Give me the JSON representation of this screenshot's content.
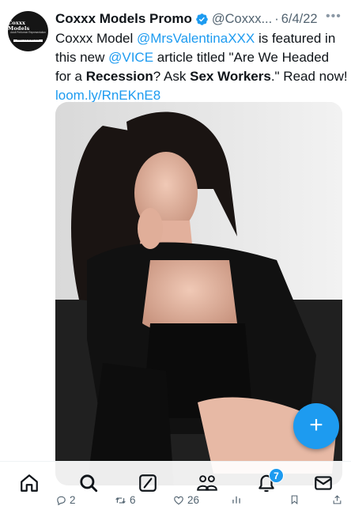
{
  "avatar": {
    "line1": "Coxxx Models",
    "line2": "Adult Performer Representation",
    "line3": "www.coxxmodels.com"
  },
  "tweet": {
    "display_name": "Coxxx Models Promo",
    "handle": "@Coxxx...",
    "separator": "·",
    "date": "6/4/22",
    "text": {
      "t1": "Coxxx Model ",
      "mention1": "@MrsValentinaXXX",
      "t2": " is featured in this new ",
      "mention2": "@VICE",
      "t3": " article titled \"Are We Headed for a ",
      "bold1": "Recession",
      "t4": "? Ask ",
      "bold2": "Sex Workers",
      "t5": ".\" Read now! ",
      "link": "loom.ly/RnEKnE8"
    }
  },
  "fab": {
    "label": "+"
  },
  "nav": {
    "items": [
      "home-icon",
      "search-icon",
      "grok-icon",
      "communities-icon",
      "notifications-icon",
      "messages-icon"
    ],
    "notifications_badge": "7"
  },
  "actions": {
    "replies": "2",
    "retweets": "6",
    "likes": "26"
  },
  "colors": {
    "accent": "#1d9bf0",
    "text": "#0f1419",
    "muted": "#536471"
  }
}
